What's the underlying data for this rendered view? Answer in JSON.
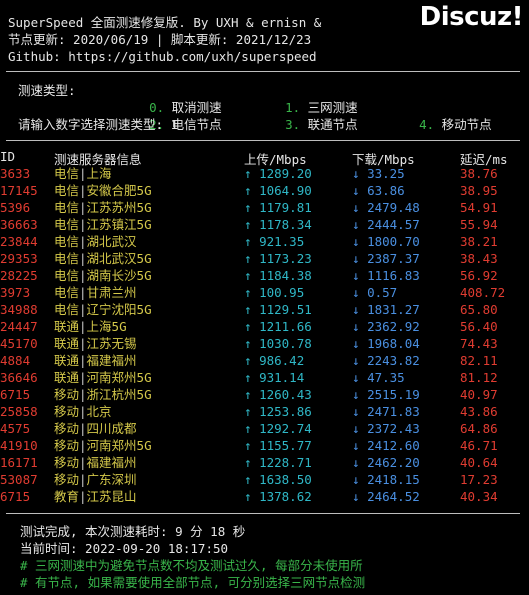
{
  "header": {
    "title_line": "SuperSpeed 全面测速修复版. By UXH & ernisn &",
    "update_line": "节点更新: 2020/06/19 | 脚本更新: 2021/12/23",
    "github_line": "Github: https://github.com/uxh/superspeed"
  },
  "watermark": "Discuz!",
  "menu": {
    "label": "测速类型:",
    "options": [
      {
        "num": "0.",
        "text": "取消测速"
      },
      {
        "num": "1.",
        "text": "三网测速"
      },
      {
        "num": "2.",
        "text": "电信节点"
      },
      {
        "num": "3.",
        "text": "联通节点"
      },
      {
        "num": "4.",
        "text": "移动节点"
      }
    ],
    "prompt": "请输入数字选择测速类型: 1"
  },
  "columns": {
    "id": "ID",
    "name": "测速服务器信息",
    "up": "上传/Mbps",
    "down": "下载/Mbps",
    "lat": "延迟/ms"
  },
  "arrows": {
    "up": "↑",
    "down": "↓"
  },
  "rows": [
    {
      "id": "3633",
      "isp": "电信",
      "loc": "上海",
      "up": "1289.20",
      "down": "33.25",
      "lat": "38.76"
    },
    {
      "id": "17145",
      "isp": "电信",
      "loc": "安徽合肥5G",
      "up": "1064.90",
      "down": "63.86",
      "lat": "38.95"
    },
    {
      "id": "5396",
      "isp": "电信",
      "loc": "江苏苏州5G",
      "up": "1179.81",
      "down": "2479.48",
      "lat": "54.91"
    },
    {
      "id": "36663",
      "isp": "电信",
      "loc": "江苏镇江5G",
      "up": "1178.34",
      "down": "2444.57",
      "lat": "55.94"
    },
    {
      "id": "23844",
      "isp": "电信",
      "loc": "湖北武汉",
      "up": "921.35",
      "down": "1800.70",
      "lat": "38.21"
    },
    {
      "id": "29353",
      "isp": "电信",
      "loc": "湖北武汉5G",
      "up": "1173.23",
      "down": "2387.37",
      "lat": "38.43"
    },
    {
      "id": "28225",
      "isp": "电信",
      "loc": "湖南长沙5G",
      "up": "1184.38",
      "down": "1116.83",
      "lat": "56.92"
    },
    {
      "id": "3973",
      "isp": "电信",
      "loc": "甘肃兰州",
      "up": "100.95",
      "down": "0.57",
      "lat": "408.72"
    },
    {
      "id": "34988",
      "isp": "电信",
      "loc": "辽宁沈阳5G",
      "up": "1129.51",
      "down": "1831.27",
      "lat": "65.80"
    },
    {
      "id": "24447",
      "isp": "联通",
      "loc": "上海5G",
      "up": "1211.66",
      "down": "2362.92",
      "lat": "56.40"
    },
    {
      "id": "45170",
      "isp": "联通",
      "loc": "江苏无锡",
      "up": "1030.78",
      "down": "1968.04",
      "lat": "74.43"
    },
    {
      "id": "4884",
      "isp": "联通",
      "loc": "福建福州",
      "up": "986.42",
      "down": "2243.82",
      "lat": "82.11"
    },
    {
      "id": "36646",
      "isp": "联通",
      "loc": "河南郑州5G",
      "up": "931.14",
      "down": "47.35",
      "lat": "81.12"
    },
    {
      "id": "6715",
      "isp": "移动",
      "loc": "浙江杭州5G",
      "up": "1260.43",
      "down": "2515.19",
      "lat": "40.97"
    },
    {
      "id": "25858",
      "isp": "移动",
      "loc": "北京",
      "up": "1253.86",
      "down": "2471.83",
      "lat": "43.86"
    },
    {
      "id": "4575",
      "isp": "移动",
      "loc": "四川成都",
      "up": "1292.74",
      "down": "2372.43",
      "lat": "64.86"
    },
    {
      "id": "41910",
      "isp": "移动",
      "loc": "河南郑州5G",
      "up": "1155.77",
      "down": "2412.60",
      "lat": "46.71"
    },
    {
      "id": "16171",
      "isp": "移动",
      "loc": "福建福州",
      "up": "1228.71",
      "down": "2462.20",
      "lat": "40.64"
    },
    {
      "id": "53087",
      "isp": "移动",
      "loc": "广东深圳",
      "up": "1638.50",
      "down": "2418.15",
      "lat": "17.23"
    },
    {
      "id": "6715",
      "isp": "教育",
      "loc": "江苏昆山",
      "up": "1378.62",
      "down": "2464.52",
      "lat": "40.34"
    }
  ],
  "footer": {
    "done": "测试完成, 本次测速耗时: 9 分 18 秒",
    "time": "当前时间: 2022-09-20 18:17:50",
    "note1": "# 三网测速中为避免节点数不均及测试过久, 每部分未使用所",
    "note2": "# 有节点, 如果需要使用全部节点, 可分别选择三网节点检测"
  },
  "colors": {
    "green": "#39b54a",
    "red": "#e03c31",
    "yellow": "#d4c84a",
    "cyan": "#2fb7c6",
    "blue": "#4a8fe0"
  }
}
